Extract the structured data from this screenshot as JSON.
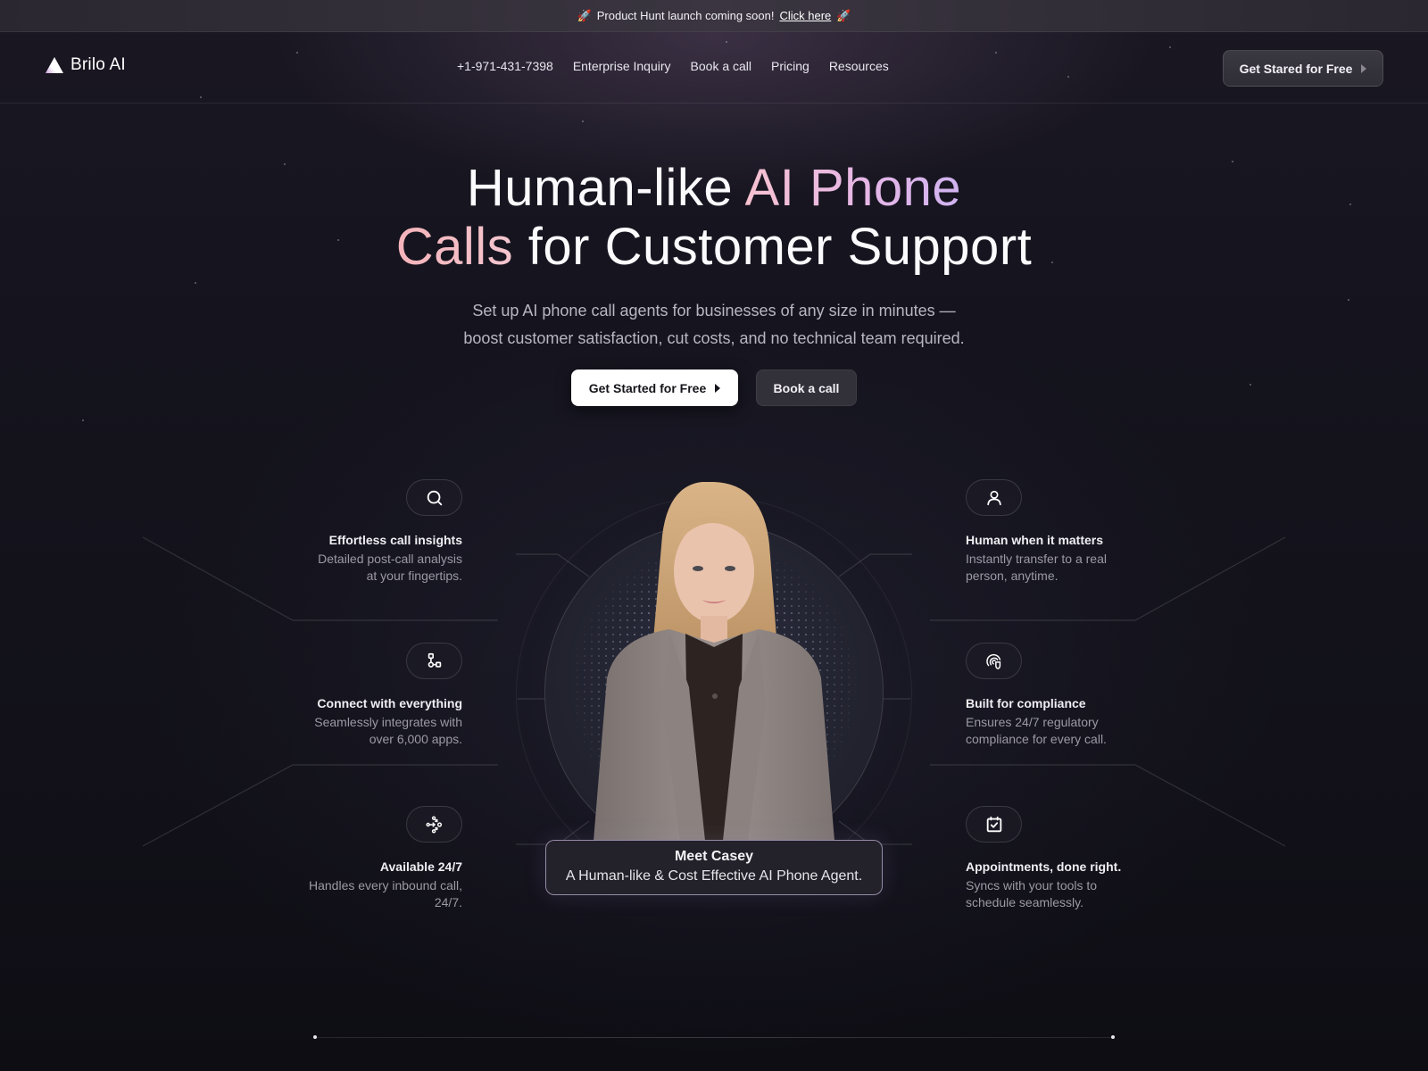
{
  "announcement": {
    "rocket_icon": "rocket-emoji",
    "rocket_glyph": "🚀",
    "text": "Product Hunt launch coming soon!",
    "link_label": "Click here"
  },
  "nav": {
    "brand": "Brilo AI",
    "links": [
      {
        "label": "+1-971-431-7398"
      },
      {
        "label": "Enterprise Inquiry"
      },
      {
        "label": "Book a call"
      },
      {
        "label": "Pricing"
      },
      {
        "label": "Resources"
      }
    ],
    "cta_label": "Get Stared for Free"
  },
  "hero": {
    "title_part1": "Human-like ",
    "title_highlight1": "AI Phone",
    "title_highlight2": "Calls",
    "title_part2": " for Customer Support",
    "subtitle_line1": "Set up AI phone call agents for businesses of any size in minutes —",
    "subtitle_line2": "boost customer satisfaction, cut costs, and no technical team required.",
    "primary_cta": "Get Started for Free",
    "secondary_cta": "Book a call"
  },
  "features": {
    "left": [
      {
        "icon": "search-icon",
        "title": "Effortless call insights",
        "desc_line1": "Detailed post-call analysis",
        "desc_line2": "at your fingertips."
      },
      {
        "icon": "integration-icon",
        "title": "Connect with everything",
        "desc_line1": "Seamlessly integrates with",
        "desc_line2": "over 6,000 apps."
      },
      {
        "icon": "routing-icon",
        "title": "Available 24/7",
        "desc_line1": "Handles every inbound call,",
        "desc_line2": "24/7."
      }
    ],
    "right": [
      {
        "icon": "user-icon",
        "title": "Human when it matters",
        "desc_line1": "Instantly transfer to a real",
        "desc_line2": "person, anytime."
      },
      {
        "icon": "fingerprint-shield-icon",
        "title": "Built for compliance",
        "desc_line1": "Ensures 24/7 regulatory",
        "desc_line2": "compliance for every call."
      },
      {
        "icon": "calendar-check-icon",
        "title": "Appointments, done right.",
        "desc_line1": "Syncs with your tools to",
        "desc_line2": "schedule seamlessly."
      }
    ]
  },
  "agent": {
    "title": "Meet Casey",
    "subtitle": "A Human-like & Cost Effective AI Phone Agent."
  },
  "colors": {
    "background": "#0f0e16",
    "highlight_pink": "#f5b3ba",
    "highlight_lavender": "#d0b3f0",
    "primary_button": "#ffffff",
    "secondary_button": "#323139"
  }
}
